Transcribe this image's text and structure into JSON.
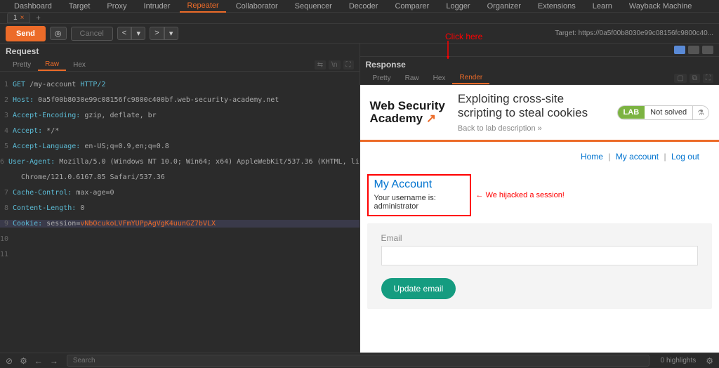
{
  "tabs": {
    "dashboard": "Dashboard",
    "target": "Target",
    "proxy": "Proxy",
    "intruder": "Intruder",
    "repeater": "Repeater",
    "collaborator": "Collaborator",
    "sequencer": "Sequencer",
    "decoder": "Decoder",
    "comparer": "Comparer",
    "logger": "Logger",
    "organizer": "Organizer",
    "extensions": "Extensions",
    "learn": "Learn",
    "wayback": "Wayback Machine"
  },
  "subtab": {
    "label": "1",
    "close": "×",
    "add": "+"
  },
  "toolbar": {
    "send": "Send",
    "cancel": "Cancel",
    "prev": "<",
    "next": ">",
    "target": "Target: https://0a5f00b8030e99c08156fc9800c40..."
  },
  "request": {
    "title": "Request",
    "views": {
      "pretty": "Pretty",
      "raw": "Raw",
      "hex": "Hex"
    },
    "lines": [
      "GET /my-account HTTP/2",
      "Host: 0a5f00b8030e99c08156fc9800c400bf.web-security-academy.net",
      "Accept-Encoding: gzip, deflate, br",
      "Accept: */*",
      "Accept-Language: en-US;q=0.9,en;q=0.8",
      "User-Agent: Mozilla/5.0 (Windows NT 10.0; Win64; x64) AppleWebKit/537.36 (KHTML, like Gecko)\n   Chrome/121.0.6167.85 Safari/537.36",
      "Cache-Control: max-age=0",
      "Content-Length: 0",
      "Cookie: session=",
      ""
    ],
    "cookie_value": "vNbOcukoLVFmYUPpAgVgK4uunGZ7bVLX"
  },
  "response": {
    "title": "Response",
    "views": {
      "pretty": "Pretty",
      "raw": "Raw",
      "hex": "Hex",
      "render": "Render"
    }
  },
  "annotations": {
    "click_here": "Click here",
    "hijacked": "We hijacked a session!"
  },
  "render": {
    "logo_line1": "Web Security",
    "logo_line2": "Academy",
    "lab_title": "Exploiting cross-site scripting to steal cookies",
    "back": "Back to lab description  »",
    "badge": "LAB",
    "status": "Not solved",
    "nav": {
      "home": "Home",
      "account": "My account",
      "logout": "Log out"
    },
    "account_title": "My Account",
    "account_text": "Your username is: administrator",
    "email_label": "Email",
    "update_btn": "Update email"
  },
  "bottom": {
    "search_placeholder": "Search",
    "highlights": "0 highlights",
    "gear": "⚙"
  }
}
